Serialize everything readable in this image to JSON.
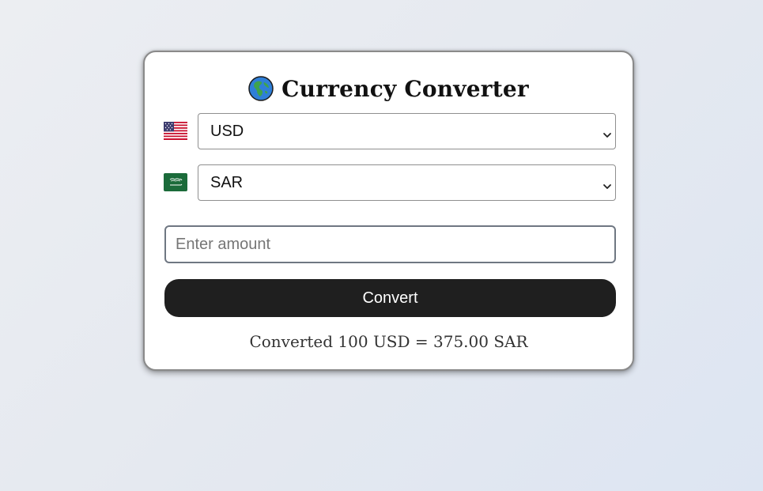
{
  "app": {
    "title": "Currency Converter",
    "title_icon": "globe-icon"
  },
  "converter": {
    "from": {
      "flag_icon": "us-flag-icon",
      "selected": "USD"
    },
    "to": {
      "flag_icon": "saudi-flag-icon",
      "selected": "SAR"
    },
    "amount": {
      "value": "",
      "placeholder": "Enter amount"
    },
    "convert_label": "Convert",
    "result_text": "Converted 100 USD = 375.00 SAR"
  },
  "colors": {
    "button_bg": "#1f1f1f",
    "button_text": "#ffffff",
    "card_bg": "#ffffff"
  }
}
